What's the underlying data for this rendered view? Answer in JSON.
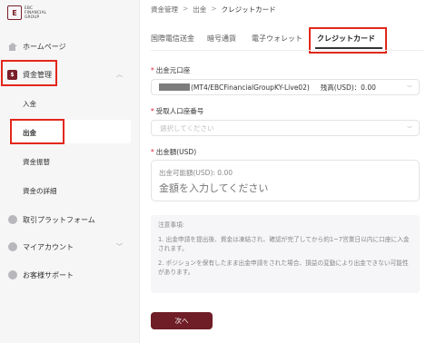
{
  "logo": {
    "mark": "E",
    "line1": "EBC",
    "line2": "FINANCIAL",
    "line3": "GROUP"
  },
  "sidebar": {
    "home": "ホームページ",
    "funds": "資金管理",
    "funds_sub": [
      "入金",
      "出金",
      "資金振替",
      "資金の詳細"
    ],
    "trading": "取引プラットフォーム",
    "account": "マイアカウント",
    "support": "お客様サポート"
  },
  "breadcrumb": [
    "資金管理",
    "出金",
    "クレジットカード"
  ],
  "breadcrumb_sep": ">",
  "tabs": [
    "国際電信送金",
    "暗号通貨",
    "電子ウォレット",
    "クレジットカード"
  ],
  "active_tab": "クレジットカード",
  "form": {
    "source_label": "出金元口座",
    "source_account": "(MT4/EBCFinancialGroupKY-Live02)",
    "source_balance": "残高(USD)：0.00",
    "recipient_label": "受取人口座番号",
    "recipient_placeholder": "選択してください",
    "amount_label": "出金額(USD)",
    "amount_available": "出金可能額(USD): 0.00",
    "amount_placeholder": "金額を入力してください"
  },
  "notice": {
    "title": "注意事項:",
    "items": [
      "1. 出金申請を提出後、資金は凍結され、確認が完了してから約1~7営業日以内に口座に入金されます。",
      "2. ポジションを保有したまま出金申請をされた場合、損益の変動により出金できない可能性があります。"
    ]
  },
  "next_button": "次へ",
  "colors": {
    "brand": "#6f1d27",
    "highlight": "#e2271b"
  }
}
